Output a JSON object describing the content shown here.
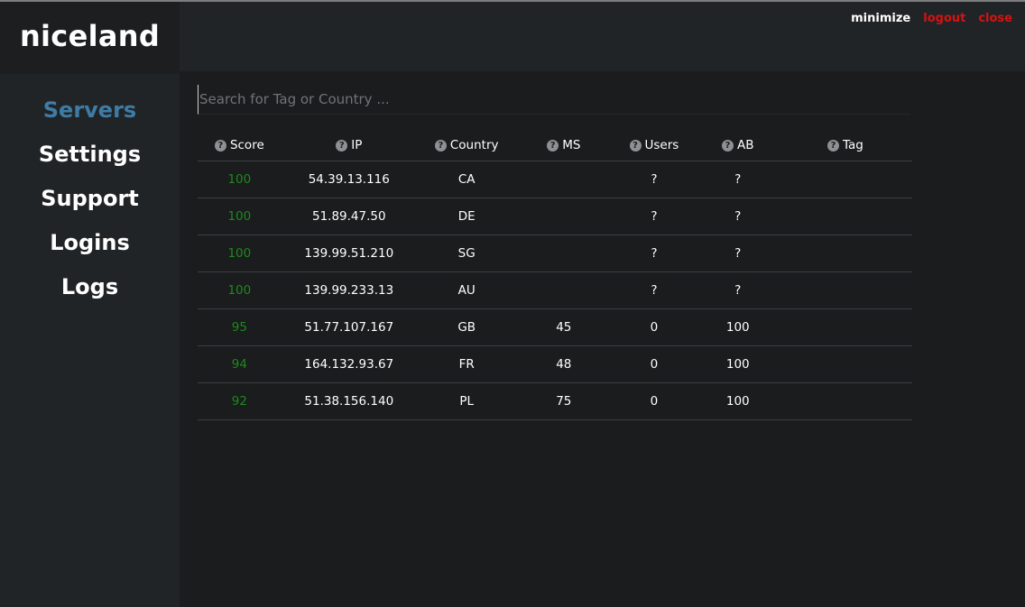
{
  "app": {
    "logo": "niceland"
  },
  "window_controls": {
    "minimize": "minimize",
    "logout": "logout",
    "close": "close"
  },
  "nav": [
    {
      "label": "Servers",
      "active": true
    },
    {
      "label": "Settings",
      "active": false
    },
    {
      "label": "Support",
      "active": false
    },
    {
      "label": "Logins",
      "active": false
    },
    {
      "label": "Logs",
      "active": false
    }
  ],
  "search": {
    "placeholder": "Search for Tag or Country ...",
    "value": ""
  },
  "table": {
    "help_icon": "?",
    "columns": [
      "Score",
      "IP",
      "Country",
      "MS",
      "Users",
      "AB",
      "Tag"
    ],
    "rows": [
      {
        "score": "100",
        "ip": "54.39.13.116",
        "country": "CA",
        "ms": "",
        "users": "?",
        "ab": "?",
        "tag": ""
      },
      {
        "score": "100",
        "ip": "51.89.47.50",
        "country": "DE",
        "ms": "",
        "users": "?",
        "ab": "?",
        "tag": ""
      },
      {
        "score": "100",
        "ip": "139.99.51.210",
        "country": "SG",
        "ms": "",
        "users": "?",
        "ab": "?",
        "tag": ""
      },
      {
        "score": "100",
        "ip": "139.99.233.13",
        "country": "AU",
        "ms": "",
        "users": "?",
        "ab": "?",
        "tag": ""
      },
      {
        "score": "95",
        "ip": "51.77.107.167",
        "country": "GB",
        "ms": "45",
        "users": "0",
        "ab": "100",
        "tag": ""
      },
      {
        "score": "94",
        "ip": "164.132.93.67",
        "country": "FR",
        "ms": "48",
        "users": "0",
        "ab": "100",
        "tag": ""
      },
      {
        "score": "92",
        "ip": "51.38.156.140",
        "country": "PL",
        "ms": "75",
        "users": "0",
        "ab": "100",
        "tag": ""
      }
    ]
  },
  "colors": {
    "accent_active_nav": "#3e7ca5",
    "score_green": "#1d8a1d",
    "danger_red": "#d41313",
    "sidebar_bg": "#212426",
    "main_bg": "#1a1c1d"
  }
}
